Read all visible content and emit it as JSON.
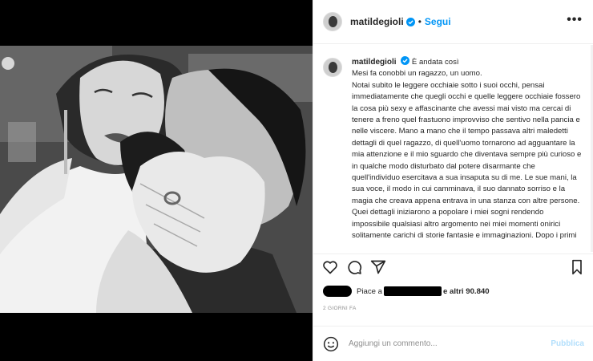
{
  "post": {
    "username": "matildegioli",
    "follow_label": "Segui",
    "more_label": "•••",
    "caption_title": "È andata così",
    "caption_lines": [
      "Mesi fa conobbi un ragazzo, un uomo.",
      "Notai subito le leggere occhiaie sotto i suoi occhi, pensai",
      "immediatamente che quegli occhi e quelle leggere occhiaie fossero",
      "la cosa più sexy e affascinante che avessi mai visto ma cercai di",
      "tenere a freno quel frastuono improvviso che sentivo nella pancia e",
      "nelle viscere. Mano a mano che il tempo passava altri maledetti",
      "dettagli di quel ragazzo, di quell'uomo tornarono ad agguantare la",
      "mia attenzione e il mio sguardo che diventava sempre più curioso e",
      "in qualche modo disturbato dal potere disarmante che",
      "quell'individuo esercitava a sua insaputa su di me. Le sue mani, la",
      "sua voce, il modo in cui camminava, il suo dannato sorriso e la",
      "magia che creava appena entrava in una stanza con altre persone.",
      "Quei dettagli iniziarono a popolare i miei sogni rendendo",
      "impossibile qualsiasi altro argomento nei miei momenti onirici",
      "solitamente carichi di storie fantasie e immaginazioni. Dopo i primi"
    ],
    "likes_prefix": "Piace a",
    "likes_suffix": "e altri 90.840",
    "date": "2 GIORNI FA",
    "comment_placeholder": "Aggiungi un commento...",
    "publish_label": "Pubblica"
  },
  "icons": {
    "verified": "verified-badge-icon",
    "like": "heart-icon",
    "comment": "comment-icon",
    "share": "paper-plane-icon",
    "save": "bookmark-icon",
    "emoji": "smiley-icon"
  },
  "colors": {
    "accent": "#0095f6",
    "publish_disabled": "#b2dffc",
    "muted": "#8e8e8e"
  }
}
